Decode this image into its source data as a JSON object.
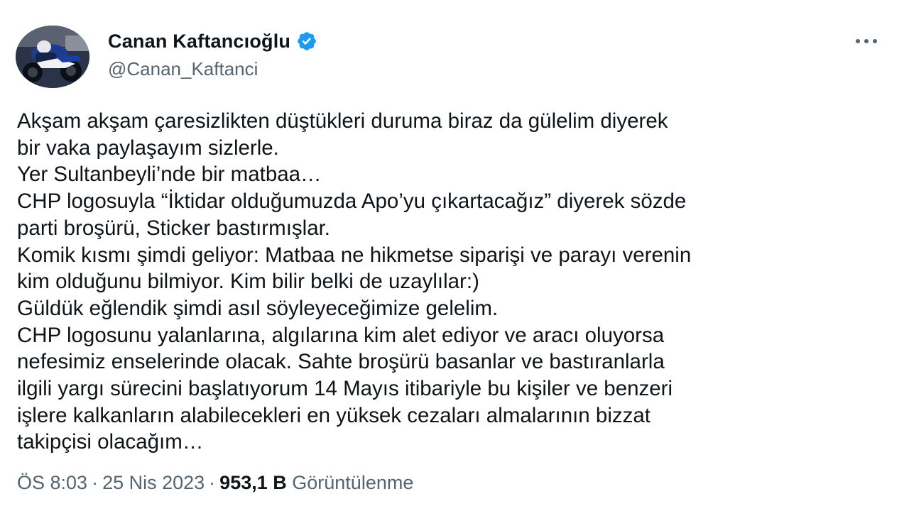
{
  "author": {
    "display_name": "Canan Kaftancıoğlu",
    "handle": "@Canan_Kaftanci",
    "verified_icon": "verified-badge-icon",
    "verified_color": "#1d9bf0"
  },
  "menu": {
    "icon": "more-options-icon"
  },
  "tweet": {
    "lines": [
      "Akşam akşam çaresizlikten düştükleri duruma biraz da gülelim diyerek",
      "bir vaka paylaşayım sizlerle.",
      "Yer Sultanbeyli’nde bir matbaa…",
      "CHP logosuyla “İktidar olduğumuzda Apo’yu çıkartacağız” diyerek sözde",
      "parti broşürü, Sticker bastırmışlar.",
      "Komik kısmı şimdi geliyor: Matbaa ne hikmetse siparişi ve parayı verenin",
      "kim olduğunu bilmiyor. Kim bilir belki de uzaylılar:)",
      "Güldük eğlendik şimdi asıl söyleyeceğimize gelelim.",
      "CHP logosunu yalanlarına, algılarına kim alet ediyor ve aracı oluyorsa",
      "nefesimiz enselerinde olacak. Sahte broşürü basanlar ve bastıranlarla",
      "ilgili yargı sürecini başlatıyorum 14 Mayıs itibariyle bu kişiler ve benzeri",
      "işlere kalkanların alabilecekleri en yüksek cezaları almalarının bizzat",
      "takipçisi olacağım…"
    ]
  },
  "meta": {
    "time": "ÖS 8:03",
    "separator": "·",
    "date": "25 Nis 2023",
    "views_count": "953,1 B",
    "views_label": "Görüntülenme"
  },
  "colors": {
    "text_primary": "#0f1419",
    "text_secondary": "#536471",
    "background": "#ffffff"
  }
}
